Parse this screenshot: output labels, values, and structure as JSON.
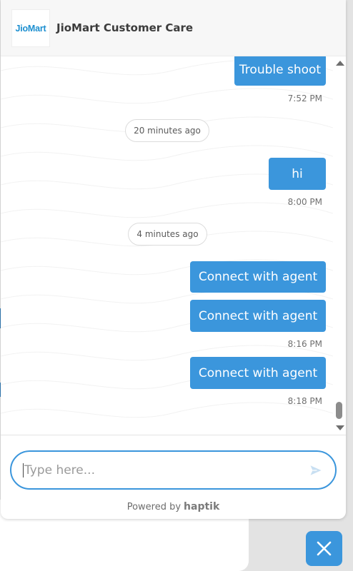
{
  "header": {
    "logo_text": "JioMart",
    "title": "JioMart Customer Care"
  },
  "messages": {
    "m1": {
      "text": "Trouble shoot",
      "time": "7:52 PM"
    },
    "sep1": "20 minutes ago",
    "m2": {
      "text": "hi",
      "time": "8:00 PM"
    },
    "sep2": "4 minutes ago",
    "m3": {
      "text": "Connect with agent"
    },
    "m4": {
      "text": "Connect with agent",
      "time": "8:16 PM"
    },
    "m5": {
      "text": "Connect with agent",
      "time": "8:18 PM"
    }
  },
  "composer": {
    "placeholder": "Type here...",
    "send_icon": "send-icon"
  },
  "footer": {
    "powered_by": "Powered by",
    "brand": "haptik"
  },
  "fab": {
    "icon": "close-icon"
  },
  "colors": {
    "accent": "#3b96dc",
    "logo": "#1d8fd0"
  }
}
